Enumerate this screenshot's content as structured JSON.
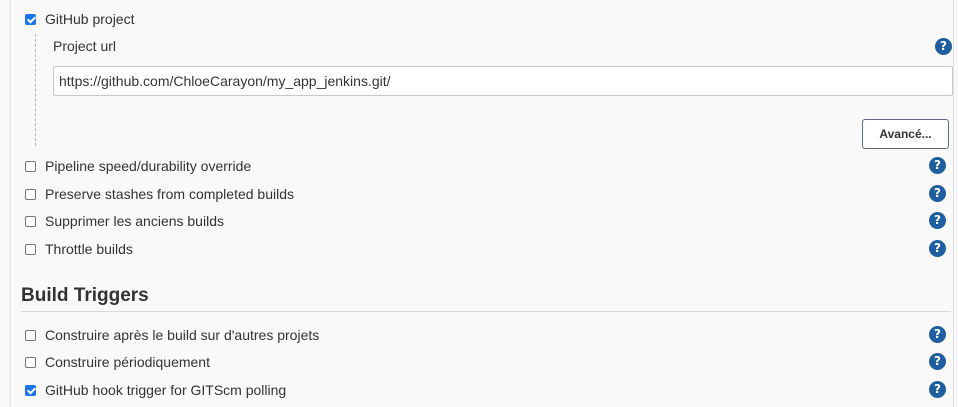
{
  "general": {
    "github_project": {
      "label": "GitHub project",
      "checked": true
    },
    "project_url": {
      "label": "Project url",
      "value": "https://github.com/ChloeCarayon/my_app_jenkins.git/"
    },
    "advanced_button": "Avancé...",
    "options": [
      {
        "label": "Pipeline speed/durability override",
        "checked": false
      },
      {
        "label": "Preserve stashes from completed builds",
        "checked": false
      },
      {
        "label": "Supprimer les anciens builds",
        "checked": false
      },
      {
        "label": "Throttle builds",
        "checked": false
      }
    ]
  },
  "build_triggers": {
    "title": "Build Triggers",
    "options": [
      {
        "label": "Construire après le build sur d'autres projets",
        "checked": false
      },
      {
        "label": "Construire périodiquement",
        "checked": false
      },
      {
        "label": "GitHub hook trigger for GITScm polling",
        "checked": true
      }
    ]
  },
  "help_icon_glyph": "?",
  "colors": {
    "help_icon": "#1f5f9f",
    "checkbox_checked": "#1a73e8"
  }
}
